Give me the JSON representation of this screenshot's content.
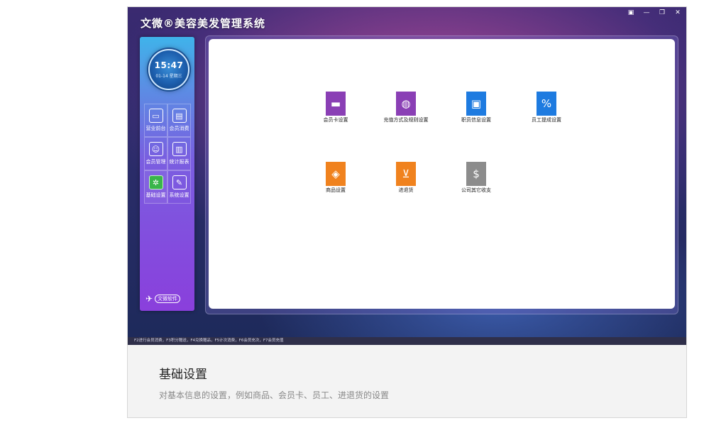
{
  "app": {
    "title": "文微®美容美发管理系统",
    "window_controls": [
      "▣",
      "—",
      "❐",
      "✕"
    ]
  },
  "clock": {
    "time": "15:47",
    "date": "01-14 星期三"
  },
  "sidebar": {
    "items": [
      {
        "label": "营业前台",
        "icon": "monitor-icon"
      },
      {
        "label": "会员消费",
        "icon": "briefcase-icon"
      },
      {
        "label": "会员管理",
        "icon": "members-icon"
      },
      {
        "label": "统计报表",
        "icon": "bar-chart-icon"
      },
      {
        "label": "基础设置",
        "icon": "settings-icon"
      },
      {
        "label": "系统设置",
        "icon": "wrench-icon"
      }
    ],
    "brand": "文微软件"
  },
  "tiles": [
    {
      "label": "会员卡设置",
      "icon": "card-icon",
      "color": "#8a3fb5"
    },
    {
      "label": "充值方式及规则设置",
      "icon": "globe-window-icon",
      "color": "#8a3fb5"
    },
    {
      "label": "职员信息设置",
      "icon": "contacts-icon",
      "color": "#1e7be0"
    },
    {
      "label": "员工提成设置",
      "icon": "percent-icon",
      "color": "#1e7be0"
    },
    {
      "label": "商品设置",
      "icon": "tag-icon",
      "color": "#f0821e"
    },
    {
      "label": "进退货",
      "icon": "cart-icon",
      "color": "#f0821e"
    },
    {
      "label": "公司其它收支",
      "icon": "money-icon",
      "color": "#8c8c8c"
    }
  ],
  "statusbar": "F2进行会员消费，F3积分赠送，F4兑换赠品，F5计次消费，F6会员充次，F7会员充值",
  "caption": {
    "title": "基础设置",
    "description": "对基本信息的设置，例如商品、会员卡、员工、进退货的设置"
  }
}
